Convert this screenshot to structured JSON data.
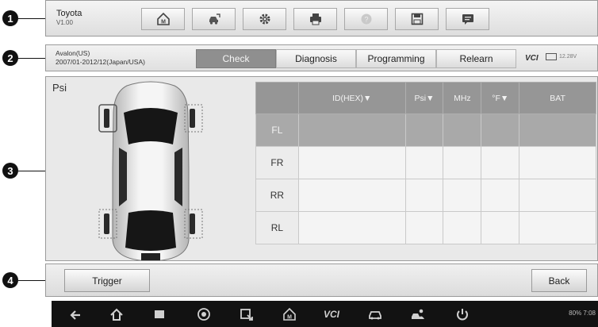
{
  "callouts": [
    "1",
    "2",
    "3",
    "4"
  ],
  "toolbar": {
    "vehicle_make": "Toyota",
    "version": "V1.00",
    "buttons": [
      "home-icon",
      "vehicle-swap-icon",
      "settings-icon",
      "print-icon",
      "help-icon",
      "save-icon",
      "data-logging-icon"
    ]
  },
  "vehicle": {
    "model": "Avalon(US)",
    "years": "2007/01-2012/12(Japan/USA)"
  },
  "tabs": [
    "Check",
    "Diagnosis",
    "Programming",
    "Relearn"
  ],
  "status": {
    "vci_label": "VCI",
    "voltage": "12.28V"
  },
  "main": {
    "unit_label": "Psi",
    "columns": [
      "",
      "ID(HEX)▼",
      "Psi▼",
      "MHz",
      "°F▼",
      "BAT"
    ],
    "rows": [
      {
        "pos": "FL",
        "id": "",
        "psi": "",
        "mhz": "",
        "temp": "",
        "bat": ""
      },
      {
        "pos": "FR",
        "id": "",
        "psi": "",
        "mhz": "",
        "temp": "",
        "bat": ""
      },
      {
        "pos": "RR",
        "id": "",
        "psi": "",
        "mhz": "",
        "temp": "",
        "bat": ""
      },
      {
        "pos": "RL",
        "id": "",
        "psi": "",
        "mhz": "",
        "temp": "",
        "bat": ""
      }
    ]
  },
  "functions": {
    "trigger_label": "Trigger",
    "back_label": "Back"
  },
  "android": {
    "icons": [
      "back-icon",
      "home-icon",
      "recents-icon",
      "browser-icon",
      "screen-capture-icon",
      "maxisys-home-icon",
      "vci-icon",
      "car-icon",
      "remote-icon",
      "power-icon"
    ],
    "vci_text": "VCI",
    "battery": "80%",
    "time": "7:08"
  }
}
